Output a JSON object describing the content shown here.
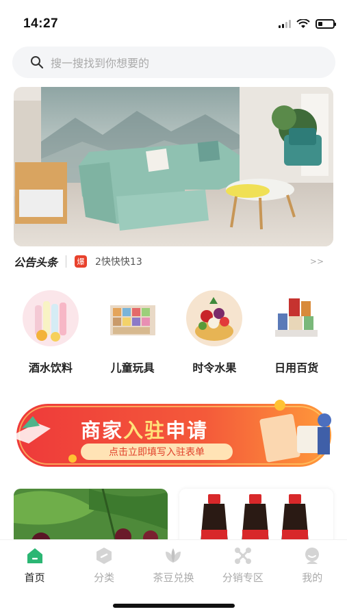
{
  "status": {
    "time": "14:27"
  },
  "search": {
    "placeholder": "搜一搜找到你想要的"
  },
  "notice": {
    "title": "公告头条",
    "badge": "爆",
    "text": "2快快快13",
    "more": ">>"
  },
  "categories": [
    {
      "label": "酒水饮料",
      "icon": "drinks-image"
    },
    {
      "label": "儿童玩具",
      "icon": "toys-image"
    },
    {
      "label": "时令水果",
      "icon": "fruit-image"
    },
    {
      "label": "日用百货",
      "icon": "daily-goods-image"
    }
  ],
  "merchant": {
    "title_part1": "商家",
    "title_part2": "入驻",
    "title_part3": "申请",
    "subtitle": "点击立即填写入驻表单"
  },
  "tabs": [
    {
      "label": "首页",
      "icon": "home-icon",
      "active": true
    },
    {
      "label": "分类",
      "icon": "category-icon",
      "active": false
    },
    {
      "label": "茶豆兑换",
      "icon": "leaf-icon",
      "active": false
    },
    {
      "label": "分销专区",
      "icon": "distribution-icon",
      "active": false
    },
    {
      "label": "我的",
      "icon": "profile-icon",
      "active": false
    }
  ],
  "colors": {
    "accent": "#2bb673",
    "merchant_red": "#ee3a3a",
    "merchant_orange": "#ff8a2a"
  }
}
